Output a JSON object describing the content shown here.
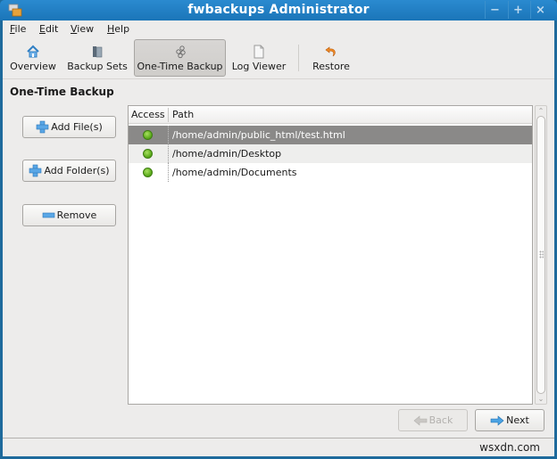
{
  "window": {
    "title": "fwbackups Administrator",
    "controls": {
      "minimize": "−",
      "maximize": "+",
      "close": "×"
    }
  },
  "menubar": {
    "items": [
      {
        "label": "File",
        "mnemonic": "F"
      },
      {
        "label": "Edit",
        "mnemonic": "E"
      },
      {
        "label": "View",
        "mnemonic": "V"
      },
      {
        "label": "Help",
        "mnemonic": "H"
      }
    ]
  },
  "toolbar": {
    "items": [
      {
        "label": "Overview",
        "icon": "home-icon"
      },
      {
        "label": "Backup Sets",
        "icon": "backup-sets-icon"
      },
      {
        "label": "One-Time Backup",
        "icon": "one-time-backup-icon",
        "active": true
      },
      {
        "label": "Log Viewer",
        "icon": "document-icon"
      },
      {
        "label": "Restore",
        "icon": "restore-icon"
      }
    ]
  },
  "page": {
    "title": "One-Time Backup",
    "buttons": {
      "add_files": "Add File(s)",
      "add_folders": "Add Folder(s)",
      "remove": "Remove"
    }
  },
  "list": {
    "columns": {
      "access": "Access",
      "path": "Path"
    },
    "rows": [
      {
        "access": "ok",
        "path": "/home/admin/public_html/test.html",
        "selected": true
      },
      {
        "access": "ok",
        "path": "/home/admin/Desktop"
      },
      {
        "access": "ok",
        "path": "/home/admin/Documents"
      }
    ]
  },
  "navigation": {
    "back": "Back",
    "back_enabled": false,
    "next": "Next"
  },
  "statusbar": {
    "watermark": "wsxdn.com"
  },
  "colors": {
    "titlebar": "#1b75b8",
    "selection": "#8a8988",
    "status_ok": "#5fae1e"
  }
}
